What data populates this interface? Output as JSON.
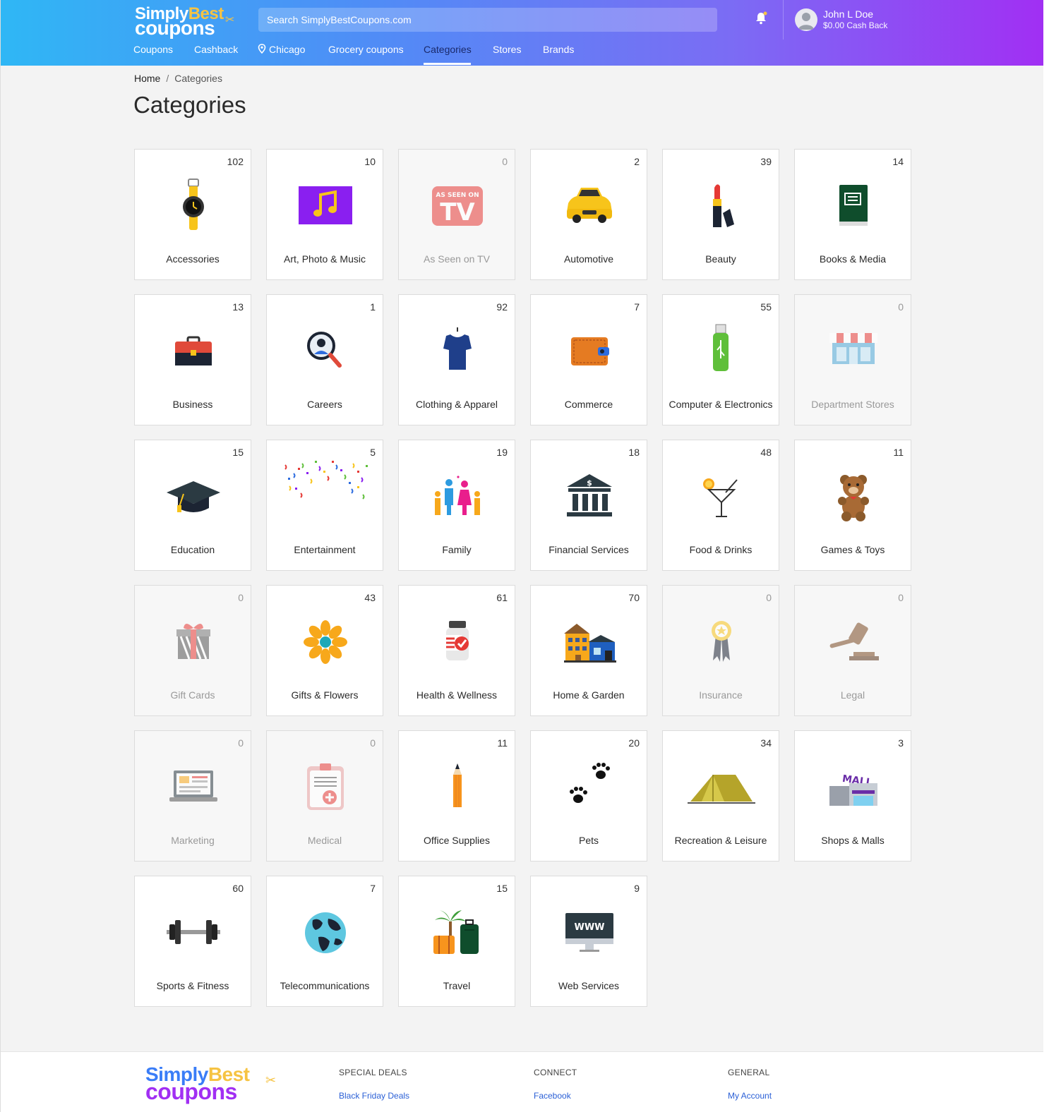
{
  "header": {
    "logo_line1a": "Simply",
    "logo_line1b": "Best",
    "logo_line2": "coupons",
    "search_placeholder": "Search SimplyBestCoupons.com",
    "user_name": "John L Doe",
    "cash_back": "$0.00 Cash Back"
  },
  "nav": {
    "items": [
      {
        "label": "Coupons"
      },
      {
        "label": "Cashback"
      },
      {
        "label": "Chicago"
      },
      {
        "label": "Grocery coupons"
      },
      {
        "label": "Categories"
      },
      {
        "label": "Stores"
      },
      {
        "label": "Brands"
      }
    ],
    "active": "Categories"
  },
  "breadcrumb": {
    "home": "Home",
    "separator": "/",
    "current": "Categories"
  },
  "page_title": "Categories",
  "categories": [
    {
      "label": "Accessories",
      "count": "102",
      "icon": "watch-icon"
    },
    {
      "label": "Art, Photo & Music",
      "count": "10",
      "icon": "music-note-icon"
    },
    {
      "label": "As Seen on TV",
      "count": "0",
      "icon": "as-seen-on-tv-icon",
      "icon_text_top": "AS SEEN ON",
      "icon_text_main": "TV"
    },
    {
      "label": "Automotive",
      "count": "2",
      "icon": "car-icon"
    },
    {
      "label": "Beauty",
      "count": "39",
      "icon": "lipstick-icon"
    },
    {
      "label": "Books & Media",
      "count": "14",
      "icon": "book-icon"
    },
    {
      "label": "Business",
      "count": "13",
      "icon": "briefcase-icon"
    },
    {
      "label": "Careers",
      "count": "1",
      "icon": "magnifier-person-icon"
    },
    {
      "label": "Clothing & Apparel",
      "count": "92",
      "icon": "tshirt-icon"
    },
    {
      "label": "Commerce",
      "count": "7",
      "icon": "wallet-icon"
    },
    {
      "label": "Computer & Electronics",
      "count": "55",
      "icon": "usb-drive-icon"
    },
    {
      "label": "Department Stores",
      "count": "0",
      "icon": "storefront-icon"
    },
    {
      "label": "Education",
      "count": "15",
      "icon": "graduation-cap-icon"
    },
    {
      "label": "Entertainment",
      "count": "5",
      "icon": "confetti-icon"
    },
    {
      "label": "Family",
      "count": "19",
      "icon": "family-icon"
    },
    {
      "label": "Financial Services",
      "count": "18",
      "icon": "bank-icon",
      "icon_text_main": "$"
    },
    {
      "label": "Food & Drinks",
      "count": "48",
      "icon": "cocktail-icon"
    },
    {
      "label": "Games & Toys",
      "count": "11",
      "icon": "teddy-bear-icon"
    },
    {
      "label": "Gift Cards",
      "count": "0",
      "icon": "gift-box-icon"
    },
    {
      "label": "Gifts & Flowers",
      "count": "43",
      "icon": "flower-icon"
    },
    {
      "label": "Health & Wellness",
      "count": "61",
      "icon": "pill-bottle-icon"
    },
    {
      "label": "Home & Garden",
      "count": "70",
      "icon": "houses-icon"
    },
    {
      "label": "Insurance",
      "count": "0",
      "icon": "award-ribbon-icon"
    },
    {
      "label": "Legal",
      "count": "0",
      "icon": "gavel-icon"
    },
    {
      "label": "Marketing",
      "count": "0",
      "icon": "laptop-icon"
    },
    {
      "label": "Medical",
      "count": "0",
      "icon": "medical-clipboard-icon"
    },
    {
      "label": "Office Supplies",
      "count": "11",
      "icon": "pencil-icon"
    },
    {
      "label": "Pets",
      "count": "20",
      "icon": "paw-prints-icon"
    },
    {
      "label": "Recreation & Leisure",
      "count": "34",
      "icon": "tent-icon"
    },
    {
      "label": "Shops & Malls",
      "count": "3",
      "icon": "mall-icon",
      "icon_text_main": "MALL"
    },
    {
      "label": "Sports & Fitness",
      "count": "60",
      "icon": "dumbbell-icon"
    },
    {
      "label": "Telecommunications",
      "count": "7",
      "icon": "globe-icon"
    },
    {
      "label": "Travel",
      "count": "15",
      "icon": "luggage-palm-icon"
    },
    {
      "label": "Web Services",
      "count": "9",
      "icon": "monitor-www-icon",
      "icon_text_main": "WWW"
    }
  ],
  "footer": {
    "logo_line1a": "Simply",
    "logo_line1b": "Best",
    "logo_line2": "coupons",
    "special_deals_heading": "SPECIAL DEALS",
    "special_deals_link": "Black Friday Deals",
    "connect_heading": "CONNECT",
    "connect_link": "Facebook",
    "general_heading": "GENERAL",
    "general_link": "My Account"
  },
  "colors": {
    "header_gradient_start": "#2fb7f5",
    "header_gradient_end": "#a12ff3",
    "logo_accent": "#f6c343",
    "link": "#2a5fd6",
    "nav_active": "#1a2a6b"
  }
}
